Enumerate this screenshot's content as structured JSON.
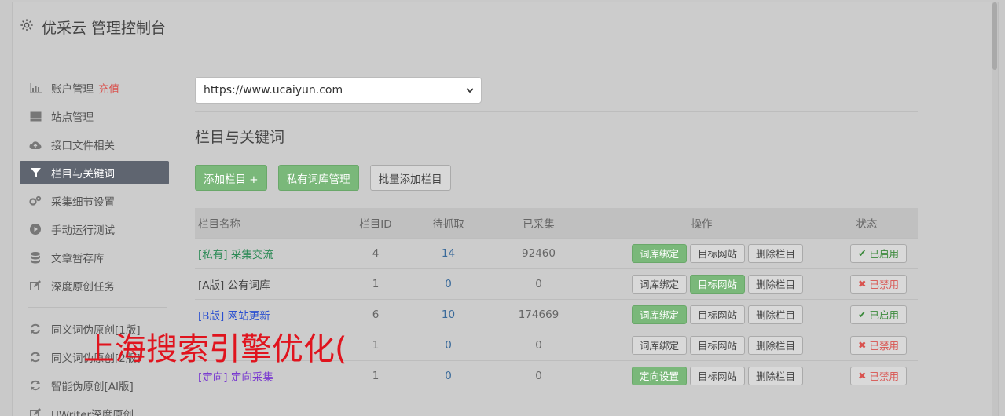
{
  "app": {
    "title": "优采云 管理控制台"
  },
  "sidebar": {
    "items": [
      {
        "label": "账户管理",
        "extra": "充值",
        "icon": "bar-chart-icon"
      },
      {
        "label": "站点管理",
        "icon": "server-icon"
      },
      {
        "label": "接口文件相关",
        "icon": "cloud-upload-icon"
      },
      {
        "label": "栏目与关键词",
        "icon": "filter-icon",
        "active": true
      },
      {
        "label": "采集细节设置",
        "icon": "gears-icon"
      },
      {
        "label": "手动运行测试",
        "icon": "play-circle-icon"
      },
      {
        "label": "文章暂存库",
        "icon": "database-icon"
      },
      {
        "label": "深度原创任务",
        "icon": "edit-icon"
      }
    ],
    "items2": [
      {
        "label": "同义词伪原创[1版]",
        "icon": "refresh-icon"
      },
      {
        "label": "同义词伪原创[2版]",
        "icon": "refresh-icon"
      },
      {
        "label": "智能伪原创[AI版]",
        "icon": "refresh-icon"
      },
      {
        "label": "UWriter深度原创",
        "icon": "edit-icon"
      }
    ]
  },
  "main": {
    "site_select": "https://www.ucaiyun.com",
    "section_title": "栏目与关键词",
    "buttons": {
      "add": "添加栏目 +",
      "private": "私有词库管理",
      "batch": "批量添加栏目"
    },
    "table": {
      "headers": [
        "栏目名称",
        "栏目ID",
        "待抓取",
        "已采集",
        "操作",
        "状态"
      ],
      "rows": [
        {
          "tag": "[私有]",
          "name": "采集交流",
          "id": "4",
          "pending": "14",
          "collected": "92460",
          "ops": [
            "词库绑定",
            "目标网站",
            "删除栏目"
          ],
          "op_on": [
            0
          ],
          "status": "已启用"
        },
        {
          "tag": "[A版]",
          "name": "公有词库",
          "id": "1",
          "pending": "0",
          "collected": "0",
          "ops": [
            "词库绑定",
            "目标网站",
            "删除栏目"
          ],
          "op_on": [
            1
          ],
          "status": "已禁用"
        },
        {
          "tag": "[B版]",
          "name": "网站更新",
          "id": "6",
          "pending": "10",
          "collected": "174669",
          "ops": [
            "词库绑定",
            "目标网站",
            "删除栏目"
          ],
          "op_on": [
            0
          ],
          "status": "已启用"
        },
        {
          "tag": "",
          "name": "",
          "id": "1",
          "pending": "0",
          "collected": "0",
          "ops": [
            "词库绑定",
            "目标网站",
            "删除栏目"
          ],
          "op_on": [],
          "status": "已禁用"
        },
        {
          "tag": "[定向]",
          "name": "定向采集",
          "id": "1",
          "pending": "0",
          "collected": "0",
          "ops": [
            "定向设置",
            "目标网站",
            "删除栏目"
          ],
          "op_on": [
            0
          ],
          "status": "已禁用"
        }
      ]
    }
  },
  "overlay": {
    "watermark": "上海搜索引擎优化("
  },
  "colors": {
    "accent_green": "#7ab87a",
    "active_nav": "#5f6570",
    "danger": "#d9534f",
    "watermark": "#e0141e"
  }
}
